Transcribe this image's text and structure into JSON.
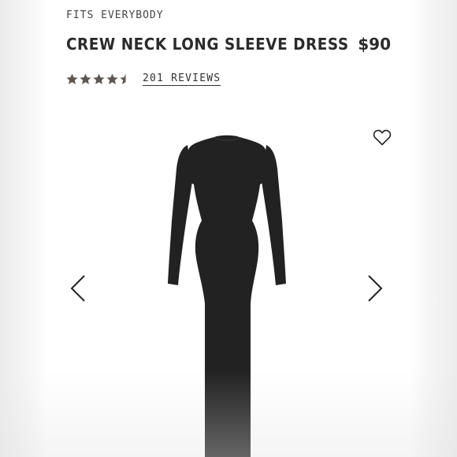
{
  "product": {
    "collection": "FITS EVERYBODY",
    "title": "CREW NECK LONG SLEEVE DRESS",
    "price": "$90",
    "rating": {
      "value": 4.5,
      "max": 5
    },
    "reviews_label": "201 REVIEWS"
  },
  "icons": {
    "favorite": "heart-outline-icon",
    "prev": "chevron-left-icon",
    "next": "chevron-right-icon",
    "star": "star-icon"
  },
  "colors": {
    "star": "#5e5650",
    "text": "#2b2b2b",
    "dress": "#222222"
  }
}
